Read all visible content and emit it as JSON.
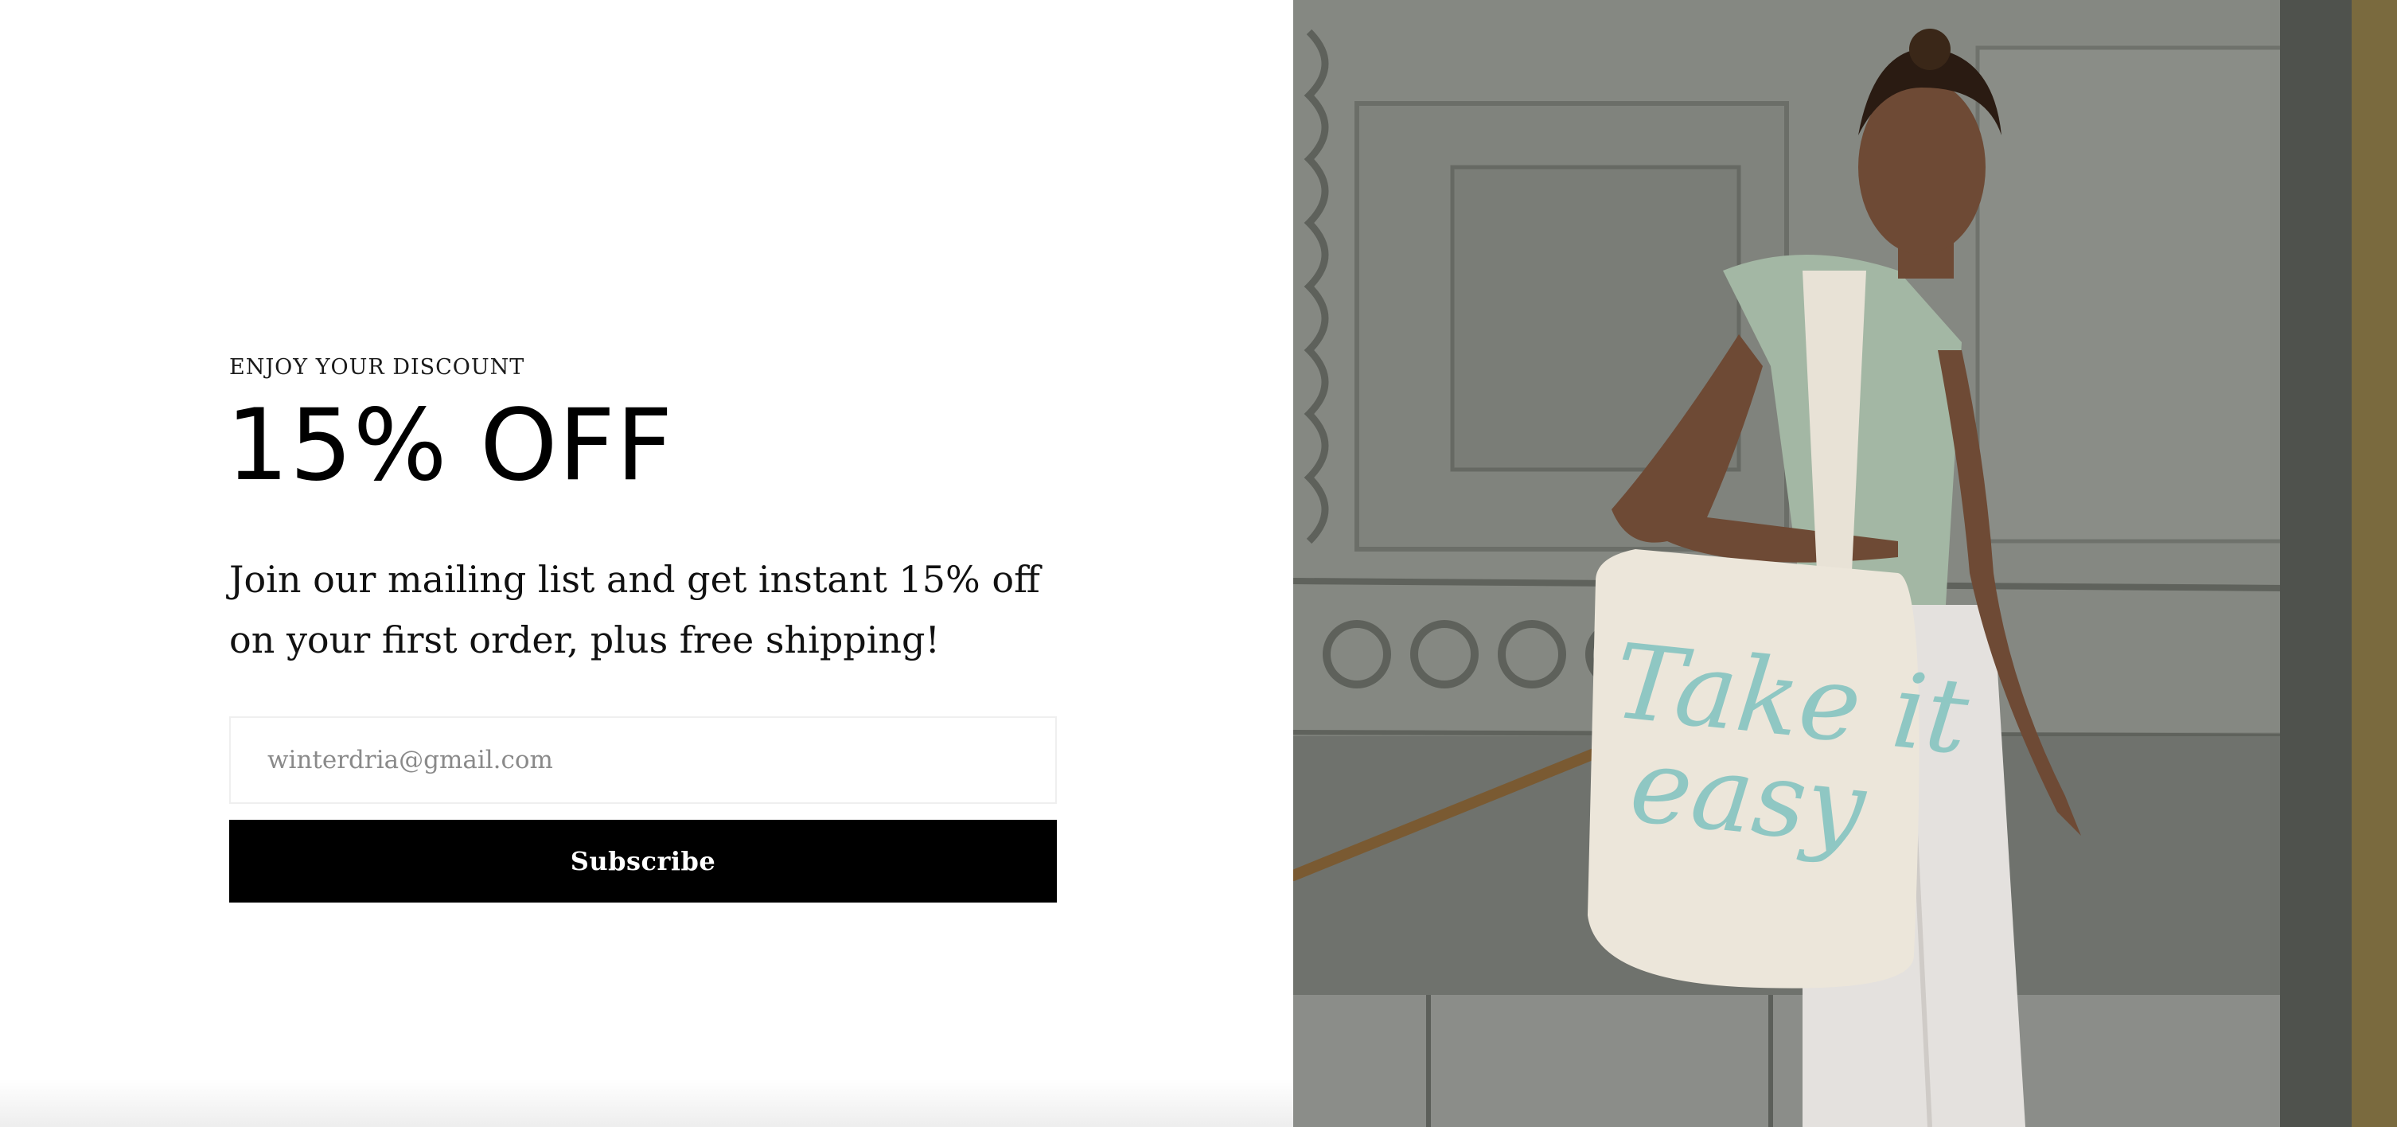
{
  "popup": {
    "eyebrow": "ENJOY YOUR DISCOUNT",
    "headline": "15% OFF",
    "description": "Join our mailing list and get instant 15% off on your first order, plus free shipping!",
    "email_value": "winterdria@gmail.com",
    "subscribe_label": "Subscribe"
  },
  "photo": {
    "tote_text_line1": "Take it",
    "tote_text_line2": "easy"
  },
  "colors": {
    "button_bg": "#000000",
    "button_text": "#ffffff",
    "tote_lettering": "#8fc7c3"
  }
}
